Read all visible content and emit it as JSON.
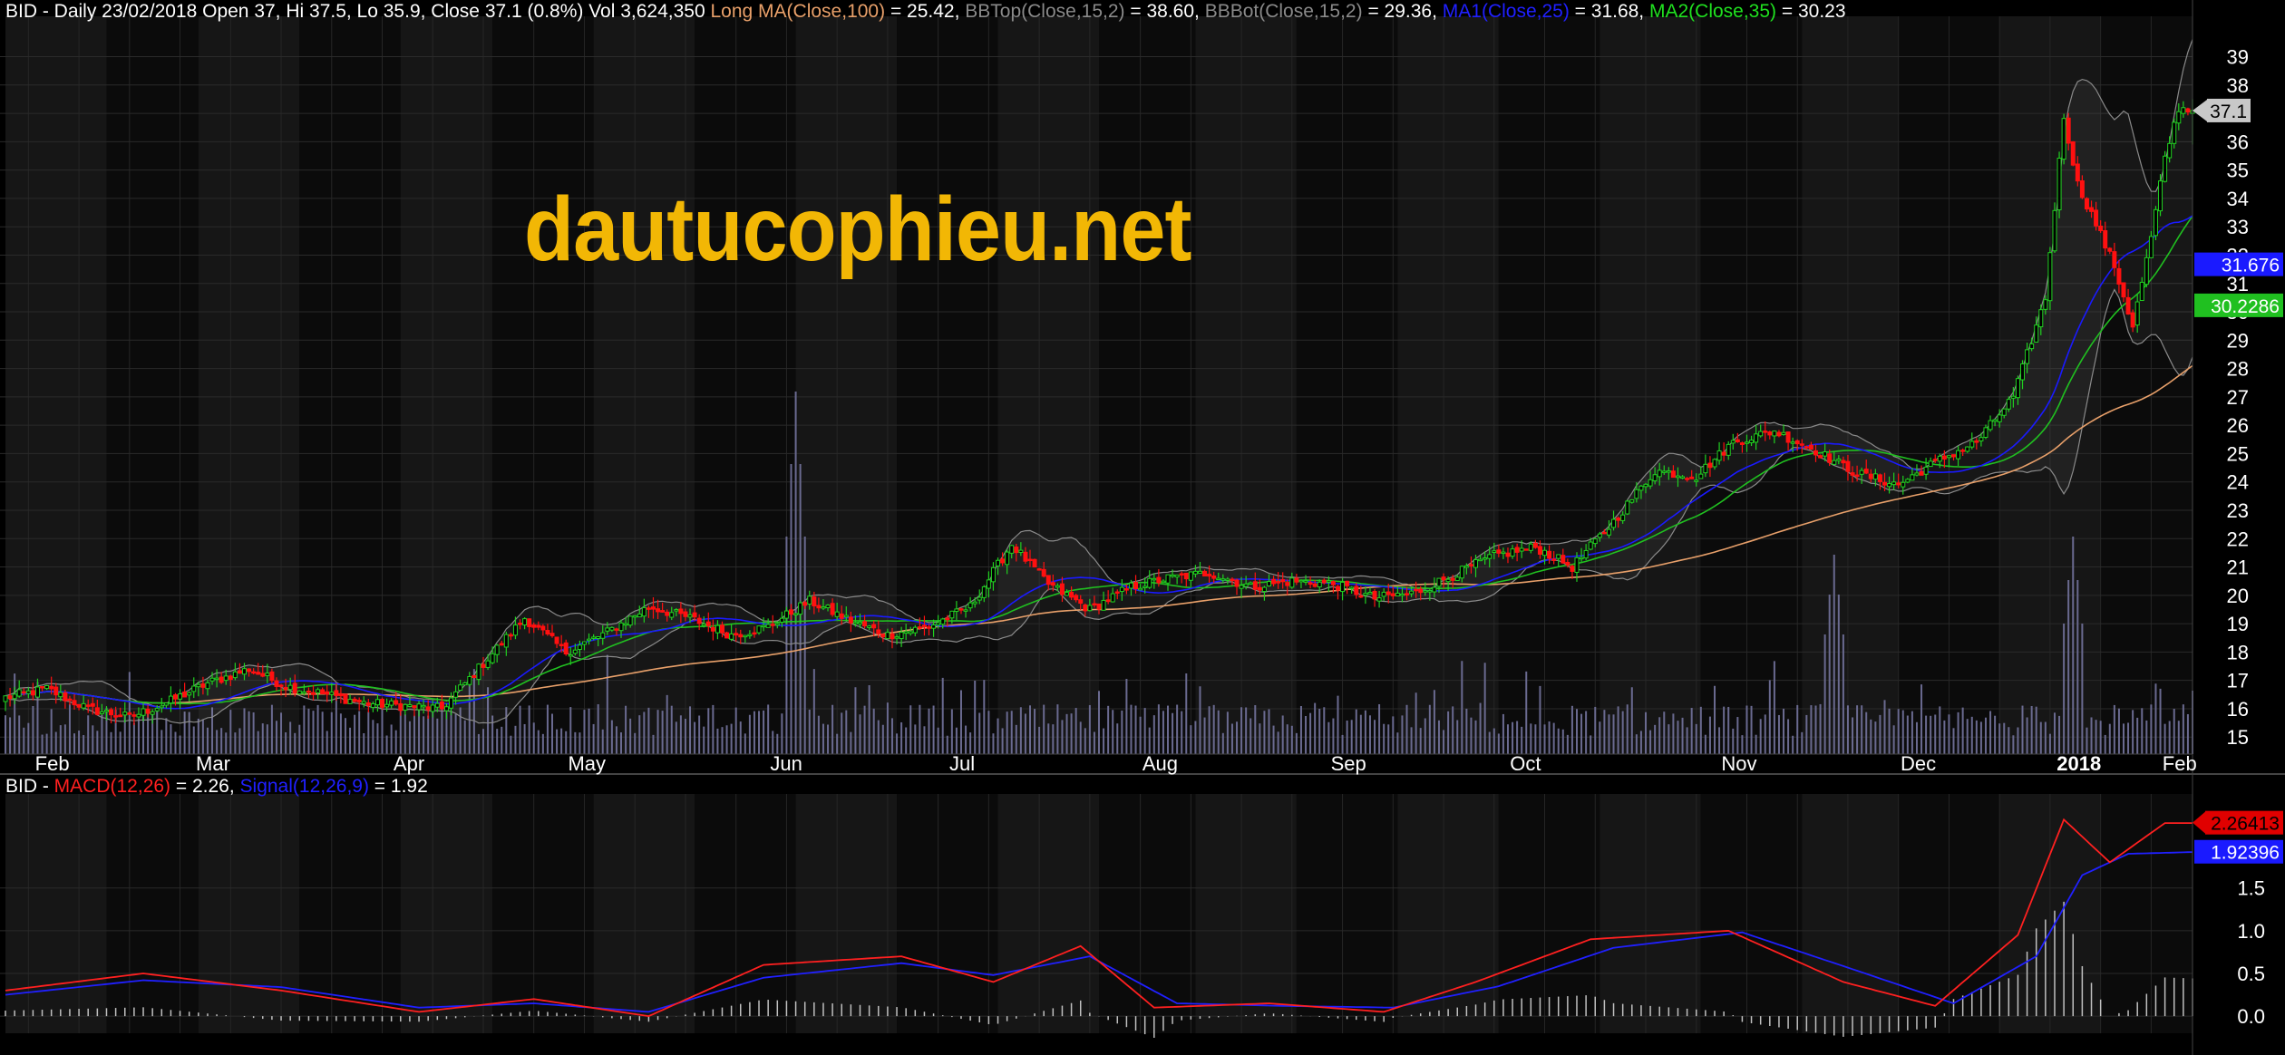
{
  "header": {
    "prefix": "BID - Daily 23/02/2018 Open 37, Hi 37.5, Lo 35.9, Close 37.1 (0.8%) Vol 3,624,350 ",
    "items": [
      {
        "label": "Long MA(Close,100)",
        "value": " = 25.42, ",
        "color": "#e8a06a"
      },
      {
        "label": "BBTop(Close,15,2)",
        "value": " = 38.60, ",
        "color": "#8a8a8a"
      },
      {
        "label": "BBBot(Close,15,2)",
        "value": " = 29.36, ",
        "color": "#8a8a8a"
      },
      {
        "label": "MA1(Close,25)",
        "value": " = 31.68, ",
        "color": "#2020ff"
      },
      {
        "label": "MA2(Close,35)",
        "value": " = 30.23",
        "color": "#20e020"
      }
    ]
  },
  "macd_header": {
    "prefix": "BID - ",
    "items": [
      {
        "label": "MACD(12,26)",
        "value": " = 2.26, ",
        "color": "#ff2020"
      },
      {
        "label": "Signal(12,26,9)",
        "value": " = 1.92",
        "color": "#2020ff"
      }
    ]
  },
  "watermark": "dautucophieu.net",
  "colors": {
    "up": "#20d020",
    "down": "#ff1010",
    "ma100": "#e8a06a",
    "bb": "#8a8a8a",
    "ma25": "#1a1aff",
    "ma35": "#20c020",
    "macd": "#ff2020",
    "signal": "#2020ff",
    "volume": "#6a6a90",
    "histogram": "#c0c0c0"
  },
  "chart_data": [
    {
      "type": "candlestick",
      "symbol": "BID",
      "interval": "Daily",
      "last_bar": {
        "date": "23/02/2018",
        "open": 37,
        "high": 37.5,
        "low": 35.9,
        "close": 37.1,
        "change_pct": 0.8,
        "volume": 3624350
      },
      "x_tick_labels": [
        "Feb",
        "Mar",
        "Apr",
        "May",
        "Jun",
        "Jul",
        "Aug",
        "Sep",
        "Oct",
        "Nov",
        "Dec",
        "2018",
        "Feb"
      ],
      "y_tick_labels": [
        15,
        16,
        17,
        18,
        19,
        20,
        21,
        22,
        23,
        24,
        25,
        26,
        27,
        28,
        29,
        30,
        31,
        32,
        33,
        34,
        35,
        36,
        37,
        38,
        39
      ],
      "ylim": [
        14.4,
        39.4
      ],
      "last_price_tag": "37.1",
      "ma_tags": [
        {
          "label": "31.676",
          "value": 31.676,
          "color": "#1a1aff"
        },
        {
          "label": "30.2286",
          "value": 30.2286,
          "color": "#20c020"
        }
      ],
      "close_path": [
        [
          0,
          16.4
        ],
        [
          9,
          16.7
        ],
        [
          18,
          16.0
        ],
        [
          27,
          15.7
        ],
        [
          35,
          16.2
        ],
        [
          44,
          16.9
        ],
        [
          53,
          17.4
        ],
        [
          61,
          16.8
        ],
        [
          70,
          16.5
        ],
        [
          78,
          16.2
        ],
        [
          87,
          16.1
        ],
        [
          95,
          16.0
        ],
        [
          104,
          17.6
        ],
        [
          113,
          19.2
        ],
        [
          122,
          18.0
        ],
        [
          131,
          18.7
        ],
        [
          140,
          19.6
        ],
        [
          149,
          19.2
        ],
        [
          158,
          18.6
        ],
        [
          166,
          18.9
        ],
        [
          175,
          19.8
        ],
        [
          184,
          19.1
        ],
        [
          192,
          18.6
        ],
        [
          201,
          18.9
        ],
        [
          210,
          19.6
        ],
        [
          219,
          21.8
        ],
        [
          227,
          20.4
        ],
        [
          236,
          19.5
        ],
        [
          245,
          20.3
        ],
        [
          253,
          20.6
        ],
        [
          262,
          20.8
        ],
        [
          271,
          20.3
        ],
        [
          280,
          20.5
        ],
        [
          289,
          20.4
        ],
        [
          298,
          19.9
        ],
        [
          307,
          20.1
        ],
        [
          315,
          20.7
        ],
        [
          324,
          21.4
        ],
        [
          333,
          21.7
        ],
        [
          341,
          21.0
        ],
        [
          350,
          22.6
        ],
        [
          359,
          24.4
        ],
        [
          368,
          24.2
        ],
        [
          376,
          25.4
        ],
        [
          385,
          25.8
        ],
        [
          394,
          25.1
        ],
        [
          403,
          24.3
        ],
        [
          412,
          23.9
        ],
        [
          420,
          24.7
        ],
        [
          429,
          25.4
        ],
        [
          437,
          27.0
        ],
        [
          444,
          30.5
        ],
        [
          448,
          36.9
        ],
        [
          451,
          34.5
        ],
        [
          455,
          33.1
        ],
        [
          459,
          31.6
        ],
        [
          463,
          29.5
        ],
        [
          467,
          32.6
        ],
        [
          470,
          35.4
        ],
        [
          473,
          37.2
        ],
        [
          476,
          37.1
        ]
      ],
      "volume_peaks": [
        {
          "day": 172,
          "relative": 1.0
        },
        {
          "day": 398,
          "relative": 0.55
        },
        {
          "day": 450,
          "relative": 0.6
        }
      ]
    },
    {
      "type": "line",
      "title": "MACD(12,26) / Signal(12,26,9)",
      "y_tick_labels": [
        "0.0",
        "0.5",
        "1.0",
        "1.5"
      ],
      "ylim": [
        -0.2,
        2.6
      ],
      "value_tags": [
        {
          "label": "2.26413",
          "value": 2.26413,
          "color": "#ff2020"
        },
        {
          "label": "1.92396",
          "value": 1.92396,
          "color": "#2020ff"
        }
      ],
      "macd_path": [
        [
          0,
          0.3
        ],
        [
          30,
          0.5
        ],
        [
          60,
          0.3
        ],
        [
          90,
          0.05
        ],
        [
          115,
          0.2
        ],
        [
          140,
          0.0
        ],
        [
          165,
          0.6
        ],
        [
          195,
          0.7
        ],
        [
          215,
          0.4
        ],
        [
          234,
          0.82
        ],
        [
          250,
          0.1
        ],
        [
          275,
          0.15
        ],
        [
          300,
          0.05
        ],
        [
          320,
          0.4
        ],
        [
          345,
          0.9
        ],
        [
          375,
          1.0
        ],
        [
          400,
          0.4
        ],
        [
          420,
          0.12
        ],
        [
          438,
          0.95
        ],
        [
          448,
          2.3
        ],
        [
          458,
          1.8
        ],
        [
          470,
          2.26
        ],
        [
          476,
          2.26
        ]
      ],
      "signal_path": [
        [
          0,
          0.25
        ],
        [
          30,
          0.42
        ],
        [
          60,
          0.34
        ],
        [
          90,
          0.1
        ],
        [
          115,
          0.15
        ],
        [
          140,
          0.05
        ],
        [
          165,
          0.45
        ],
        [
          195,
          0.62
        ],
        [
          215,
          0.48
        ],
        [
          236,
          0.7
        ],
        [
          255,
          0.15
        ],
        [
          278,
          0.12
        ],
        [
          302,
          0.1
        ],
        [
          325,
          0.35
        ],
        [
          350,
          0.8
        ],
        [
          378,
          0.98
        ],
        [
          402,
          0.55
        ],
        [
          424,
          0.15
        ],
        [
          442,
          0.7
        ],
        [
          452,
          1.65
        ],
        [
          462,
          1.9
        ],
        [
          476,
          1.92
        ]
      ]
    }
  ]
}
